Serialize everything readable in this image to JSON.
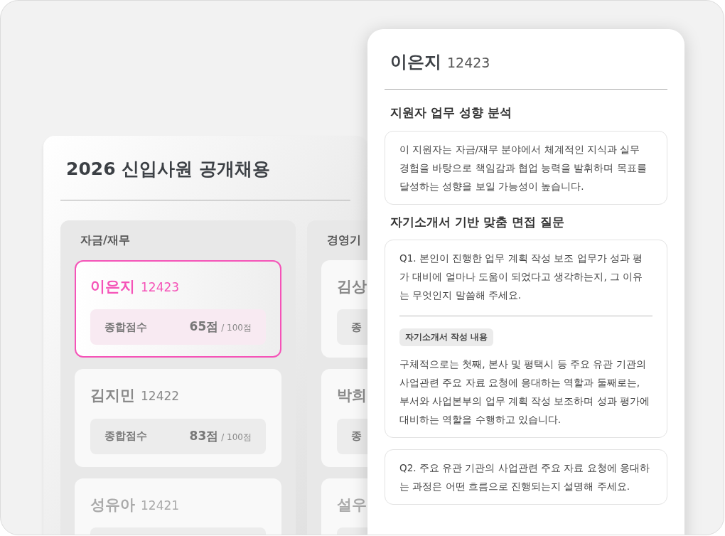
{
  "page_title": "2026 신입사원 공개채용",
  "columns": [
    {
      "title": "자금/재무",
      "cards": [
        {
          "name": "이은지",
          "id": "12423",
          "selected": true,
          "score_label": "종합점수",
          "score": "65점",
          "score_max": "/ 100점"
        },
        {
          "name": "김지민",
          "id": "12422",
          "selected": false,
          "score_label": "종합점수",
          "score": "83점",
          "score_max": "/ 100점"
        },
        {
          "name": "성유아",
          "id": "12421",
          "selected": false
        }
      ]
    },
    {
      "title": "경영기",
      "cards": [
        {
          "name": "김상",
          "selected": false,
          "score_label": "종"
        },
        {
          "name": "박희",
          "selected": false,
          "score_label": "종"
        },
        {
          "name": "설우",
          "selected": false
        }
      ]
    }
  ],
  "detail": {
    "name": "이은지",
    "id": "12423",
    "sections": [
      {
        "heading": "지원자 업무 성향 분석",
        "blocks": [
          {
            "kind": "text",
            "text": "이 지원자는 자금/재무 분야에서 체계적인 지식과 실무 경험을 바탕으로 책임감과 협업 능력을 발휘하며 목표를 달성하는 성향을 보일 가능성이 높습니다."
          }
        ]
      },
      {
        "heading": "자기소개서 기반 맞춤 면접 질문",
        "blocks": [
          {
            "kind": "question",
            "question": "Q1. 본인이 진행한 업무 계획 작성 보조 업무가 성과 평가 대비에 얼마나 도움이 되었다고 생각하는지, 그 이유는 무엇인지 말씀해 주세요.",
            "tag": "자기소개서 작성 내용",
            "answer": "구체적으로는 첫째, 본사 및 평택시 등 주요 유관 기관의 사업관련 주요 자료 요청에 응대하는 역할과 둘째로는, 부서와 사업본부의 업무 계획 작성 보조하며 성과 평가에 대비하는 역할을 수행하고 있습니다."
          },
          {
            "kind": "question",
            "question": "Q2. 주요 유관 기관의 사업관련 주요 자료 요청에 응대하는 과정은 어떤 흐름으로 진행되는지 설명해 주세요."
          }
        ]
      }
    ]
  }
}
